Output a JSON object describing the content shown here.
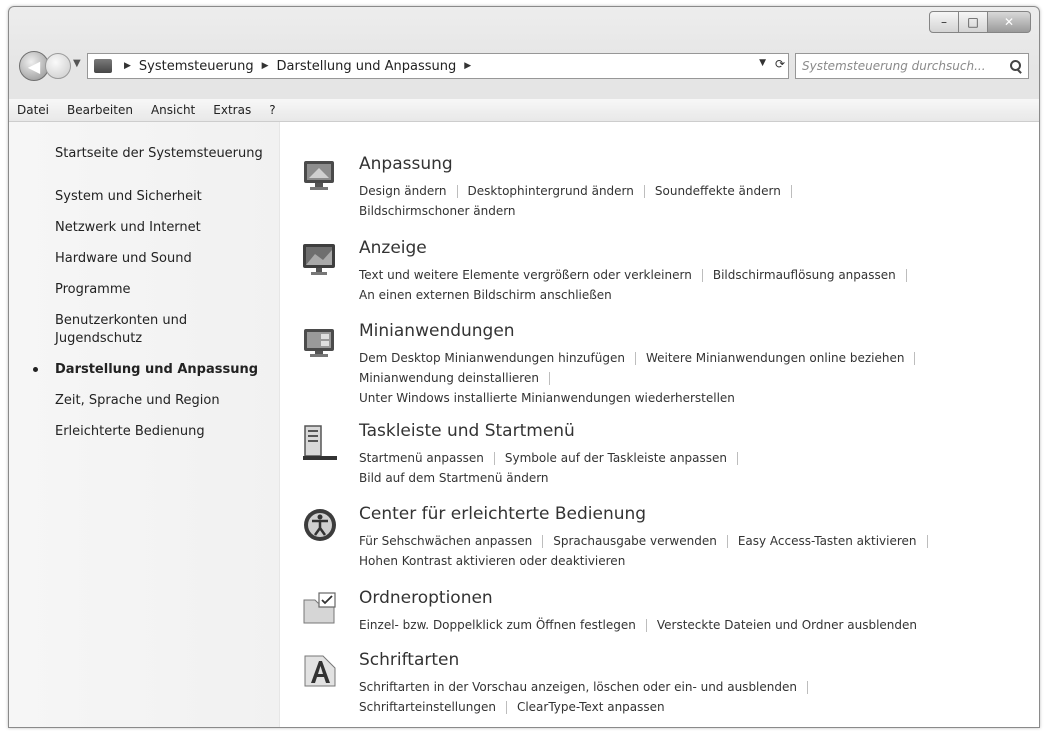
{
  "window": {
    "caption": {
      "minimize": "–",
      "maximize": "□",
      "close": "✕"
    }
  },
  "nav": {
    "crumbs": [
      "Systemsteuerung",
      "Darstellung und Anpassung"
    ],
    "search_placeholder": "Systemsteuerung durchsuch..."
  },
  "menu": [
    "Datei",
    "Bearbeiten",
    "Ansicht",
    "Extras",
    "?"
  ],
  "left": {
    "home": "Startseite der Systemsteuerung",
    "links": [
      "System und Sicherheit",
      "Netzwerk und Internet",
      "Hardware und Sound",
      "Programme",
      "Benutzerkonten und Jugendschutz",
      "Darstellung und Anpassung",
      "Zeit, Sprache und Region",
      "Erleichterte Bedienung"
    ]
  },
  "categories": [
    {
      "icon": "monitor-personalize-icon",
      "title": "Anpassung",
      "links": [
        "Design ändern",
        "Desktophintergrund ändern",
        "Soundeffekte ändern",
        "Bildschirmschoner ändern"
      ]
    },
    {
      "icon": "display-icon",
      "title": "Anzeige",
      "links": [
        "Text und weitere Elemente vergrößern oder verkleinern",
        "Bildschirmauflösung anpassen",
        "An einen externen Bildschirm anschließen"
      ]
    },
    {
      "icon": "gadgets-icon",
      "title": "Minianwendungen",
      "links": [
        "Dem Desktop Minianwendungen hinzufügen",
        "Weitere Minianwendungen online beziehen",
        "Minianwendung deinstallieren",
        "Unter Windows installierte Minianwendungen wiederherstellen"
      ]
    },
    {
      "icon": "taskbar-icon",
      "title": "Taskleiste und Startmenü",
      "links": [
        "Startmenü anpassen",
        "Symbole auf der Taskleiste anpassen",
        "Bild auf dem Startmenü ändern"
      ]
    },
    {
      "icon": "ease-of-access-icon",
      "title": "Center für erleichterte Bedienung",
      "links": [
        "Für Sehschwächen anpassen",
        "Sprachausgabe verwenden",
        "Easy Access-Tasten aktivieren",
        "Hohen Kontrast aktivieren oder deaktivieren"
      ]
    },
    {
      "icon": "folder-options-icon",
      "title": "Ordneroptionen",
      "links": [
        "Einzel- bzw. Doppelklick zum Öffnen festlegen",
        "Versteckte Dateien und Ordner ausblenden"
      ]
    },
    {
      "icon": "fonts-icon",
      "title": "Schriftarten",
      "links": [
        "Schriftarten in der Vorschau anzeigen, löschen oder ein- und ausblenden",
        "Schriftarteinstellungen",
        "ClearType-Text anpassen"
      ]
    }
  ]
}
